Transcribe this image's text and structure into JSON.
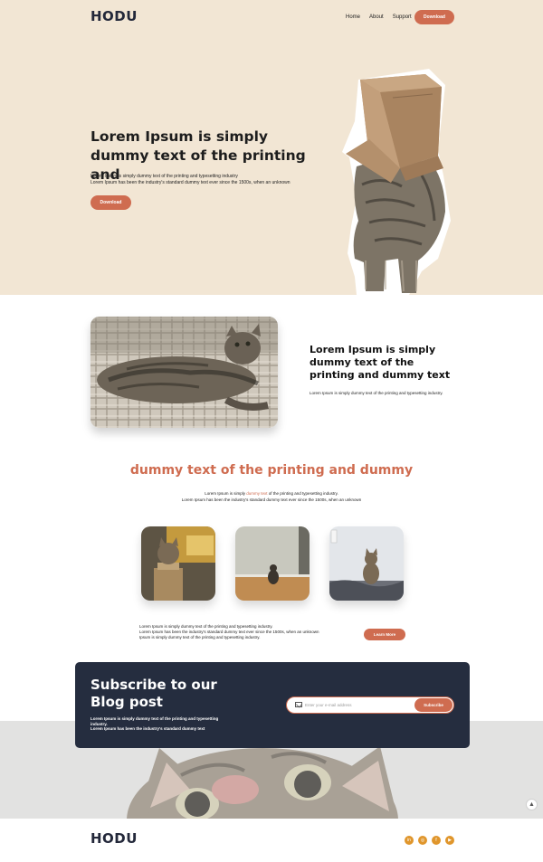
{
  "brand": {
    "name": "HODU",
    "accent": "#cf6c50",
    "dark": "#252d3f",
    "hero_bg": "#f2e6d4"
  },
  "nav": {
    "items": [
      "Home",
      "About",
      "Support"
    ],
    "cta": "Download"
  },
  "hero": {
    "title": "Lorem Ipsum is simply dummy text of the printing and",
    "subtitle_line1": "Lorem Ipsum is simply dummy text of the printing and typesetting industry",
    "subtitle_line2": "Lorem Ipsum has been the industry's standard dummy text ever since the 1500s, when an unknown",
    "button": "Download"
  },
  "feature": {
    "title": "Lorem Ipsum is simply dummy text of the printing and dummy text",
    "text": "Lorem Ipsum is simply dummy text of the printing and typesetting industry."
  },
  "gallery": {
    "title": "dummy text of the printing and dummy",
    "sub_prefix": "Lorem Ipsum is simply ",
    "sub_highlight": "dummy text",
    "sub_suffix": " of the printing and typesetting industry.",
    "sub_line2": "Lorem Ipsum has been the industry's standard dummy text ever since the 1500s, when an unknown"
  },
  "info": {
    "line1": "Lorem Ipsum is simply dummy text of the printing and typesetting industry.",
    "line2": "Lorem Ipsum has been the industry's standard dummy text ever since the 1500s, when an unknown",
    "line3": "Ipsum is simply dummy text of the printing and typesetting industry.",
    "button": "Learn More"
  },
  "subscribe": {
    "title": "Subscribe to our Blog post",
    "text_line1": "Lorem Ipsum is simply dummy text of the printing and typesetting industry.",
    "text_line2": "Lorem Ipsum has been the industry's standard dummy text",
    "placeholder": "Enter your e-mail address",
    "button": "Subscribe"
  },
  "footer": {
    "logo": "HODU",
    "social_icons": [
      "linkedin-icon",
      "instagram-icon",
      "facebook-icon",
      "youtube-icon"
    ]
  }
}
